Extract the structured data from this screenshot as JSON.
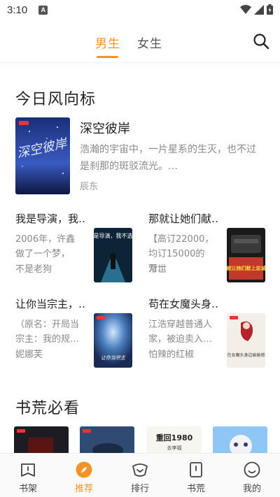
{
  "status_bar": {
    "time": "3:10",
    "notification": "A"
  },
  "top_tabs": {
    "male": "男生",
    "female": "女生"
  },
  "sections": {
    "today": "今日风向标",
    "must_read": "书荒必看"
  },
  "featured": {
    "title": "深空彼岸",
    "desc": "浩瀚的宇宙中，一片星系的生灭，也不过是刹那的斑驳流光。…",
    "author": "辰东",
    "cover_text": "深空彼岸"
  },
  "books": [
    {
      "title": "我是导演，我…",
      "desc": "2006年，许鑫\n做了一个梦，\n",
      "author": "不是老狗",
      "cover_text": "我是导演，我不选烂"
    },
    {
      "title": "那就让她们献…",
      "desc": "【高订22000，\n均订15000的万…",
      "author": "常世",
      "cover_text": "那就让她们献上忠诚吧"
    },
    {
      "title": "让你当宗主，…",
      "desc": "（原名：开局当\n宗主：我的规…",
      "author": "妮娜芙",
      "cover_text": "让你当宗主"
    },
    {
      "title": "苟在女魔头身…",
      "desc": "江浩穿越普通人\n家，被迫卖入…",
      "author": "怕辣的红椒",
      "cover_text": "苟在女魔头身边偷偷修炼"
    }
  ],
  "must_read_covers": [
    {
      "label": ""
    },
    {
      "label": ""
    },
    {
      "label": "重回1980"
    },
    {
      "label": ""
    }
  ],
  "bottom_nav": [
    {
      "label": "书架",
      "icon": "bookshelf-icon"
    },
    {
      "label": "推荐",
      "icon": "compass-icon"
    },
    {
      "label": "排行",
      "icon": "ranking-icon"
    },
    {
      "label": "书荒",
      "icon": "book-famine-icon"
    },
    {
      "label": "我的",
      "icon": "profile-icon"
    }
  ],
  "colors": {
    "accent": "#f0942a",
    "text": "#222222",
    "muted": "#888888"
  }
}
